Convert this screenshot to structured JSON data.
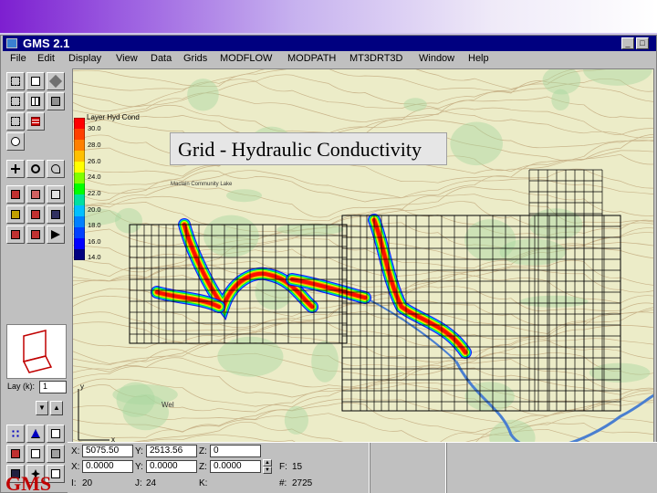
{
  "window": {
    "title": "GMS 2.1",
    "min_symbol": "_",
    "max_symbol": "□"
  },
  "menu": [
    "File",
    "Edit",
    "Display",
    "View",
    "Data",
    "Grids",
    "MODFLOW",
    "MODPATH",
    "MT3DRT3D",
    "Window",
    "Help"
  ],
  "caption": "Grid - Hydraulic Conductivity",
  "legend": {
    "title": "Layer Hyd Cond",
    "labels": [
      "30.0",
      "28.0",
      "26.0",
      "24.0",
      "22.0",
      "20.0",
      "18.0",
      "16.0",
      "14.0"
    ],
    "colors": [
      "#ff0000",
      "#ff4000",
      "#ff8000",
      "#ffc000",
      "#ffff00",
      "#80ff00",
      "#00ff00",
      "#00e0a0",
      "#00c0ff",
      "#0080ff",
      "#0040ff",
      "#0000ff",
      "#000080"
    ]
  },
  "map_labels": {
    "place": "Maclain Community Lake",
    "area": "Wel"
  },
  "layer": {
    "label": "Lay (k):",
    "value": "1"
  },
  "axis": {
    "x": "x",
    "y": "y"
  },
  "status": {
    "x_label": "X:",
    "x_value": "5075.50",
    "y_label": "Y:",
    "y_value": "2513.56",
    "z_label": "Z:",
    "z_value": "0",
    "x2_label": "X:",
    "x2_value": "0.0000",
    "y2_label": "Y:",
    "y2_value": "0.0000",
    "z2_label": "Z:",
    "z2_value": "0.0000",
    "i_label": "I:",
    "i_value": "20",
    "j_label": "J:",
    "j_value": "24",
    "k_label": "K:",
    "k_value": "",
    "f_label": "F:",
    "f_value": "15",
    "hash_label": "#:",
    "hash_value": "2725"
  },
  "logo": "GMS",
  "icons": [
    "select-cell-icon",
    "select-row-icon",
    "select-layer-icon",
    "create-point-icon",
    "zoom-icon",
    "pan-icon",
    "rotate-icon",
    "frame-icon",
    "ortho-icon",
    "oblique-icon",
    "refresh-icon",
    "cube-icon",
    "grid-icon",
    "edit-icon",
    "data-icon"
  ],
  "grid_color": "#000000",
  "map_bg": "#ececc8",
  "contour_color": "#c9b48a",
  "stream_color": "#4a7fd0",
  "veg_color": "#a8d8a0"
}
